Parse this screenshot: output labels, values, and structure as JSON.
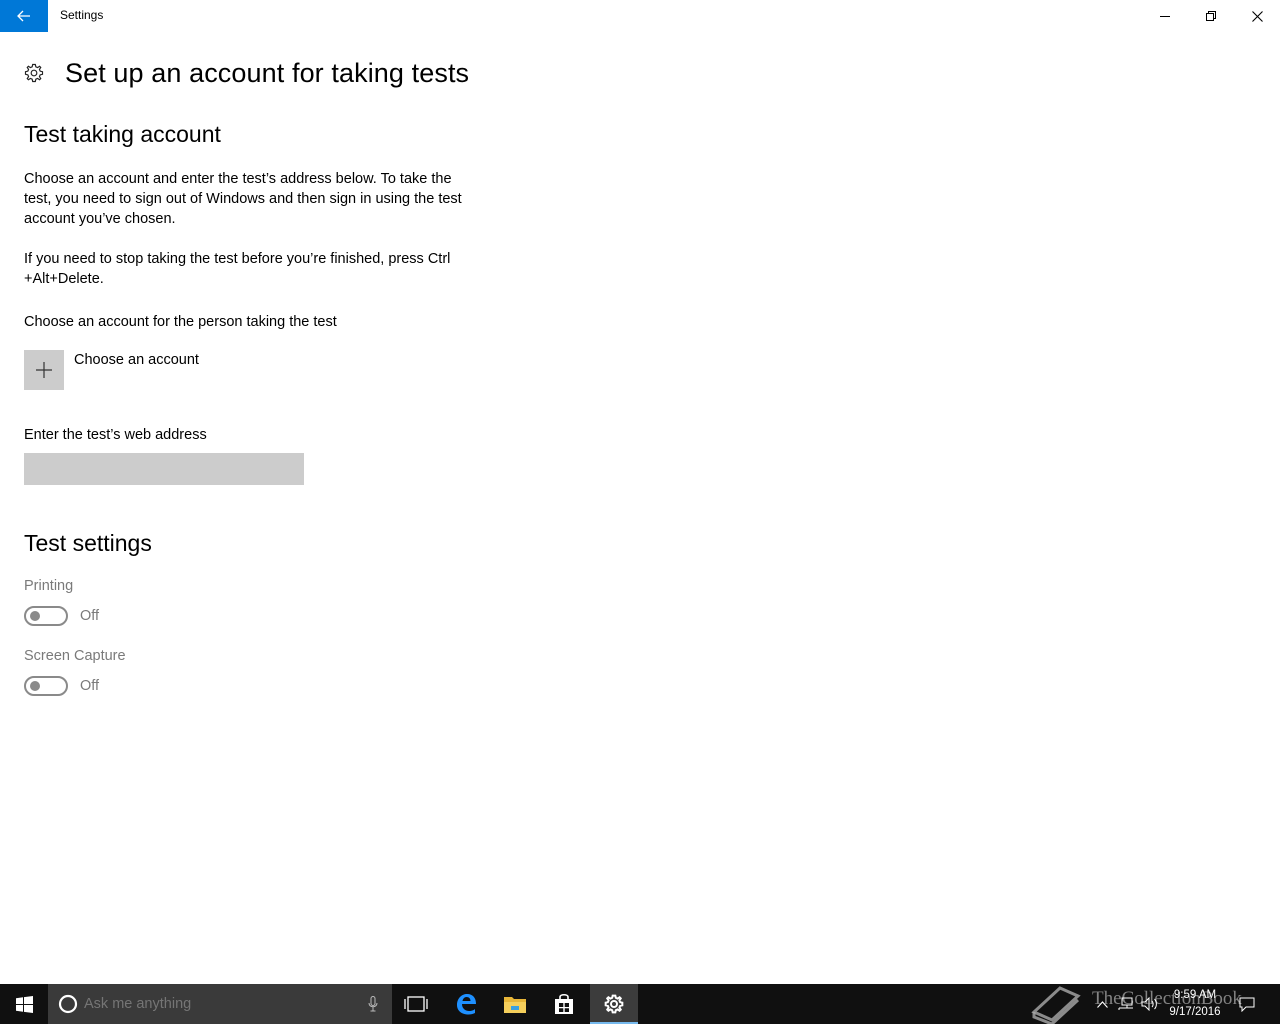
{
  "window": {
    "title": "Settings"
  },
  "page": {
    "title": "Set up an account for taking tests"
  },
  "account_section": {
    "title": "Test taking account",
    "description_1": "Choose an account and enter the test’s address below. To take the test, you need to sign out of Windows and then sign in using the test account you’ve chosen.",
    "description_2": "If you need to stop taking the test before you’re finished, press Ctrl +Alt+Delete.",
    "choose_label": "Choose an account for the person taking the test",
    "choose_button_label": "Choose an account",
    "web_address_label": "Enter the test’s web address",
    "web_address_value": ""
  },
  "test_settings": {
    "title": "Test settings",
    "items": [
      {
        "label": "Printing",
        "state": "Off"
      },
      {
        "label": "Screen Capture",
        "state": "Off"
      }
    ]
  },
  "taskbar": {
    "search_placeholder": "Ask me anything",
    "pinned": [
      "task-view-icon",
      "edge-icon",
      "file-explorer-icon",
      "store-icon",
      "settings-icon"
    ],
    "active": "settings-icon",
    "clock_time": "9:59 AM",
    "clock_date": "9/17/2016",
    "watermark": "TheCollectionBook"
  },
  "colors": {
    "accent": "#0078d7",
    "taskbar": "#101010",
    "disabled_text": "#7a7a7a",
    "tile": "#cccccc"
  }
}
